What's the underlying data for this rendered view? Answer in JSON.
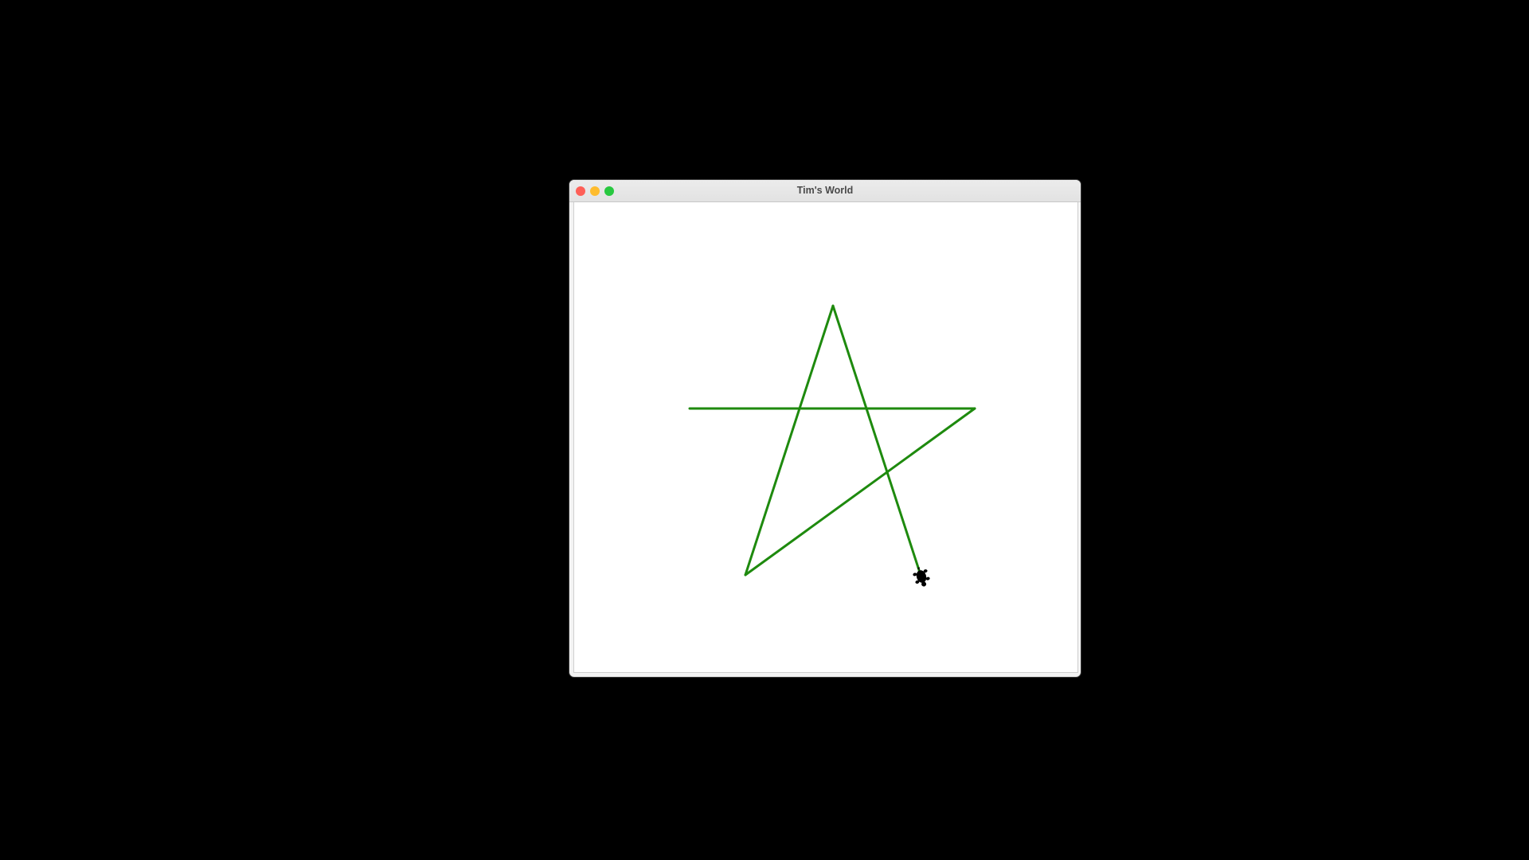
{
  "window": {
    "title": "Tim's World"
  },
  "turtle": {
    "pen_color": "#1e8a0e",
    "turtle_color": "#000000",
    "shape": "turtle-icon"
  },
  "colors": {
    "close": "#fe5f57",
    "minimize": "#febc2e",
    "zoom": "#28c840"
  }
}
